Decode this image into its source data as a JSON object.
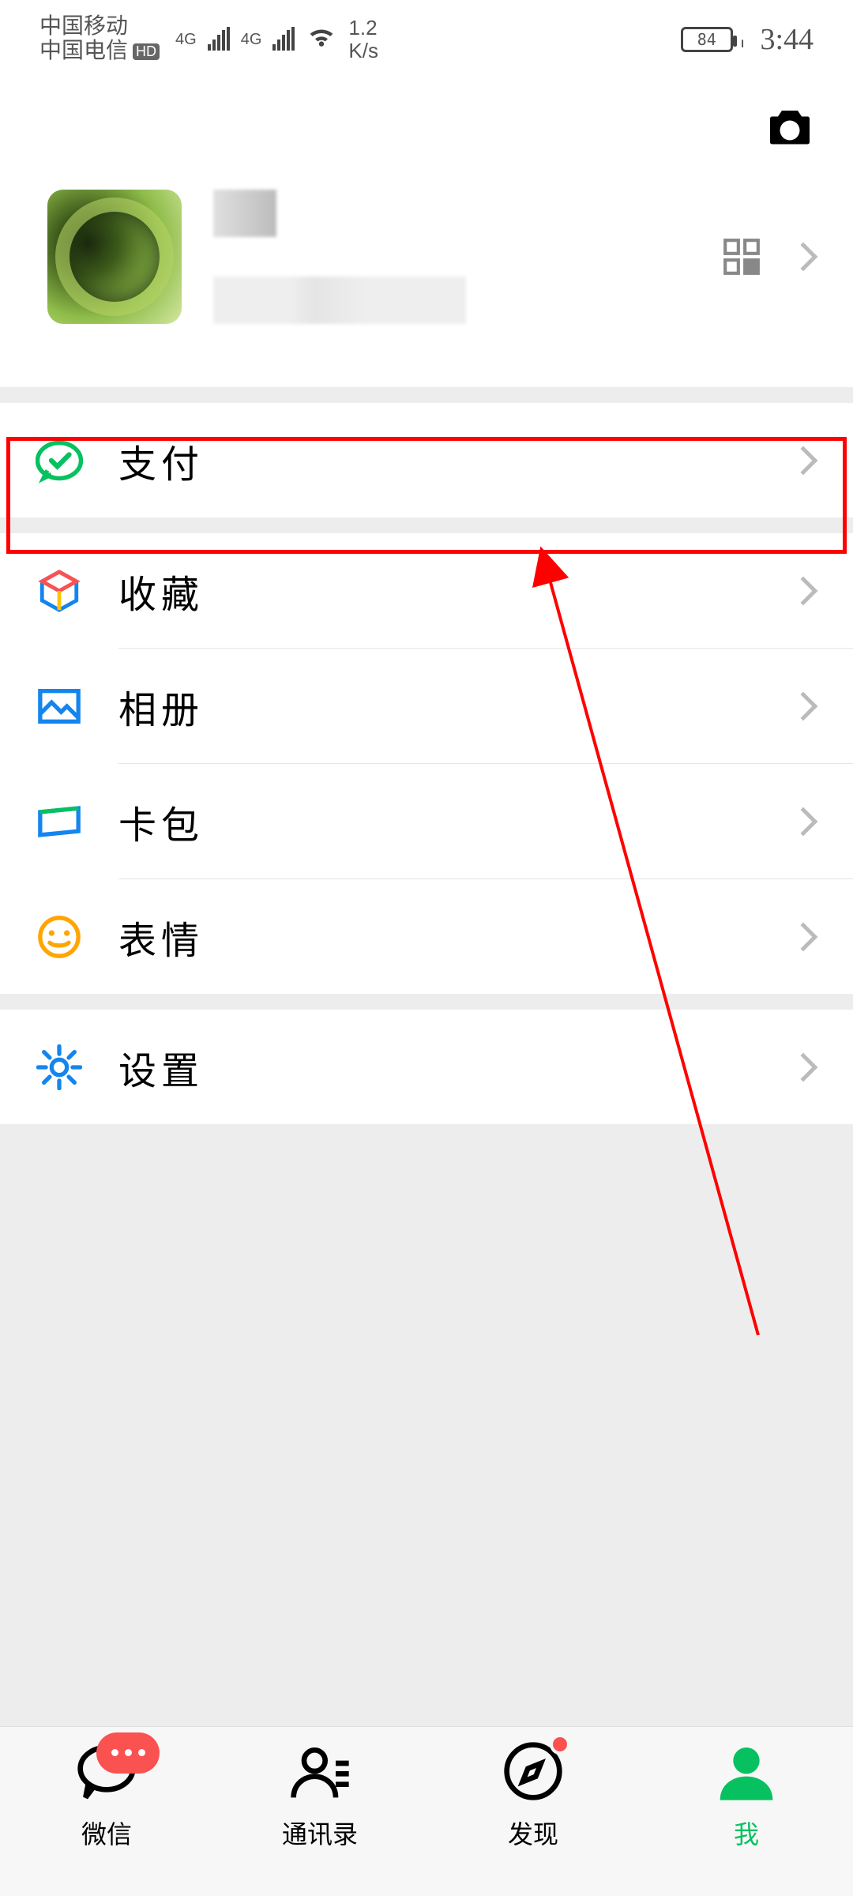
{
  "status": {
    "carrier1": "中国移动",
    "carrier2": "中国电信",
    "hd": "HD",
    "net1": "4G",
    "net2": "4G",
    "speed_num": "1.2",
    "speed_unit": "K/s",
    "battery": "84",
    "time": "3:44"
  },
  "profile": {
    "name": "",
    "wxid": ""
  },
  "menu": {
    "pay": "支付",
    "favorites": "收藏",
    "album": "相册",
    "cards": "卡包",
    "stickers": "表情",
    "settings": "设置"
  },
  "tabs": {
    "chat": "微信",
    "contacts": "通讯录",
    "discover": "发现",
    "me": "我"
  }
}
